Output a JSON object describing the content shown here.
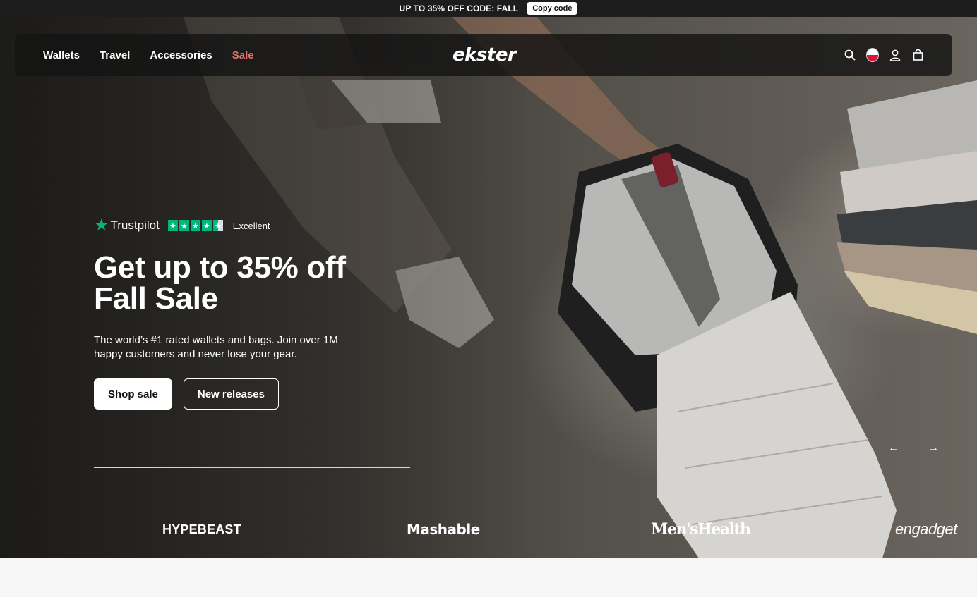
{
  "promo": {
    "text": "UP TO 35% OFF CODE: FALL",
    "copy_label": "Copy code"
  },
  "nav": {
    "links": [
      "Wallets",
      "Travel",
      "Accessories",
      "Sale"
    ],
    "logo": "ekster",
    "icons": [
      "search-icon",
      "poland-flag-icon",
      "account-icon",
      "cart-icon"
    ]
  },
  "hero": {
    "trustpilot": {
      "brand": "Trustpilot",
      "rating_text": "Excellent",
      "stars": 4.5
    },
    "headline_line1": "Get up to 35% off",
    "headline_line2": "Fall Sale",
    "subtext": "The world’s #1 rated wallets and bags. Join over 1M happy customers and never lose your gear.",
    "primary_cta": "Shop sale",
    "secondary_cta": "New releases",
    "prev_arrow": "←",
    "next_arrow": "→"
  },
  "press": [
    "HYPEBEAST",
    "Mashable",
    "Men'sHealth",
    "engadget"
  ],
  "colors": {
    "sale_link": "#e0736a",
    "trustpilot_green": "#00b67a",
    "promo_bg": "#1d1d1d"
  }
}
